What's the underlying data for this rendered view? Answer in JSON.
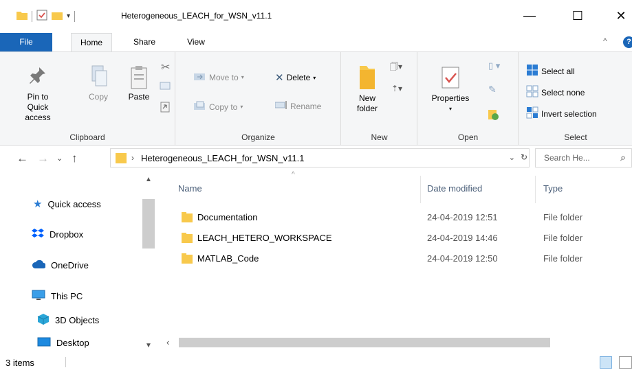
{
  "window": {
    "title": "Heterogeneous_LEACH_for_WSN_v11.1",
    "minimize": "—",
    "maximize": "☐",
    "close": "✕"
  },
  "tabs": {
    "file": "File",
    "home": "Home",
    "share": "Share",
    "view": "View",
    "collapse": "^"
  },
  "ribbon": {
    "clipboard": {
      "label": "Clipboard",
      "pin": "Pin to Quick access",
      "copy": "Copy",
      "paste": "Paste"
    },
    "organize": {
      "label": "Organize",
      "move_to": "Move to",
      "copy_to": "Copy to",
      "delete": "Delete",
      "rename": "Rename"
    },
    "new": {
      "label": "New",
      "new_folder": "New folder"
    },
    "open": {
      "label": "Open",
      "properties": "Properties"
    },
    "select": {
      "label": "Select",
      "select_all": "Select all",
      "select_none": "Select none",
      "invert": "Invert selection"
    }
  },
  "address": {
    "path": "Heterogeneous_LEACH_for_WSN_v11.1",
    "search_placeholder": "Search He..."
  },
  "nav": {
    "items": [
      {
        "label": "Quick access",
        "icon": "star-icon"
      },
      {
        "label": "Dropbox",
        "icon": "dropbox-icon"
      },
      {
        "label": "OneDrive",
        "icon": "cloud-icon"
      },
      {
        "label": "This PC",
        "icon": "computer-icon"
      },
      {
        "label": "3D Objects",
        "icon": "cube-icon"
      },
      {
        "label": "Desktop",
        "icon": "desktop-icon"
      }
    ]
  },
  "files": {
    "columns": [
      "Name",
      "Date modified",
      "Type"
    ],
    "rows": [
      {
        "name": "Documentation",
        "date": "24-04-2019 12:51",
        "type": "File folder"
      },
      {
        "name": "LEACH_HETERO_WORKSPACE",
        "date": "24-04-2019 14:46",
        "type": "File folder"
      },
      {
        "name": "MATLAB_Code",
        "date": "24-04-2019 12:50",
        "type": "File folder"
      }
    ]
  },
  "status": {
    "count": "3 items"
  },
  "colors": {
    "accent": "#1a66b8",
    "folder": "#f8c94c",
    "ribbon_bg": "#f5f6f7"
  }
}
